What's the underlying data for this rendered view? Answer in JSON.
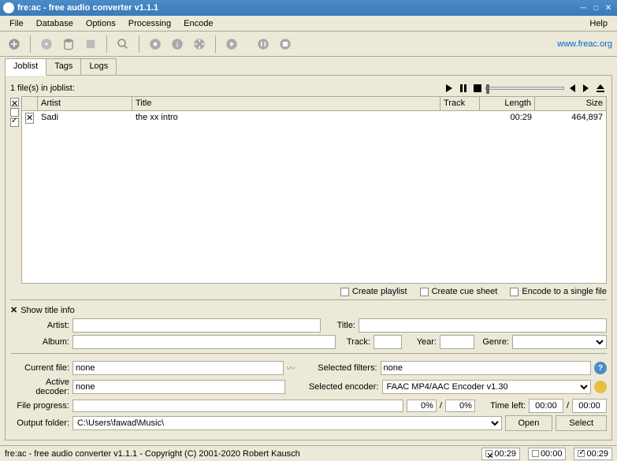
{
  "window": {
    "title": "fre:ac - free audio converter v1.1.1"
  },
  "menu": {
    "file": "File",
    "database": "Database",
    "options": "Options",
    "processing": "Processing",
    "encode": "Encode",
    "help": "Help"
  },
  "toolbar": {
    "website": "www.freac.org"
  },
  "tabs": {
    "joblist": "Joblist",
    "tags": "Tags",
    "logs": "Logs"
  },
  "joblist": {
    "status": "1 file(s) in joblist:",
    "headers": {
      "artist": "Artist",
      "title": "Title",
      "track": "Track",
      "length": "Length",
      "size": "Size"
    },
    "rows": [
      {
        "artist": "Sadi",
        "title": "the xx intro",
        "track": "",
        "length": "00:29",
        "size": "464,897"
      }
    ]
  },
  "options": {
    "create_playlist": "Create playlist",
    "create_cue": "Create cue sheet",
    "encode_single": "Encode to a single file"
  },
  "titleinfo": {
    "header": "Show title info",
    "labels": {
      "artist": "Artist:",
      "title": "Title:",
      "album": "Album:",
      "track": "Track:",
      "year": "Year:",
      "genre": "Genre:"
    }
  },
  "conversion": {
    "labels": {
      "current_file": "Current file:",
      "selected_filters": "Selected filters:",
      "active_decoder": "Active decoder:",
      "selected_encoder": "Selected encoder:",
      "file_progress": "File progress:",
      "time_left": "Time left:",
      "output_folder": "Output folder:"
    },
    "current_file": "none",
    "selected_filters": "none",
    "active_decoder": "none",
    "selected_encoder": "FAAC MP4/AAC Encoder v1.30",
    "progress1": "0%",
    "progress2": "0%",
    "time_left1": "00:00",
    "time_left2": "00:00",
    "output_folder": "C:\\Users\\fawad\\Music\\",
    "buttons": {
      "open": "Open",
      "select": "Select"
    },
    "slash": "/"
  },
  "statusbar": {
    "text": "fre:ac - free audio converter v1.1.1 - Copyright (C) 2001-2020 Robert Kausch",
    "time1": "00:29",
    "time2": "00:00",
    "time3": "00:29"
  }
}
